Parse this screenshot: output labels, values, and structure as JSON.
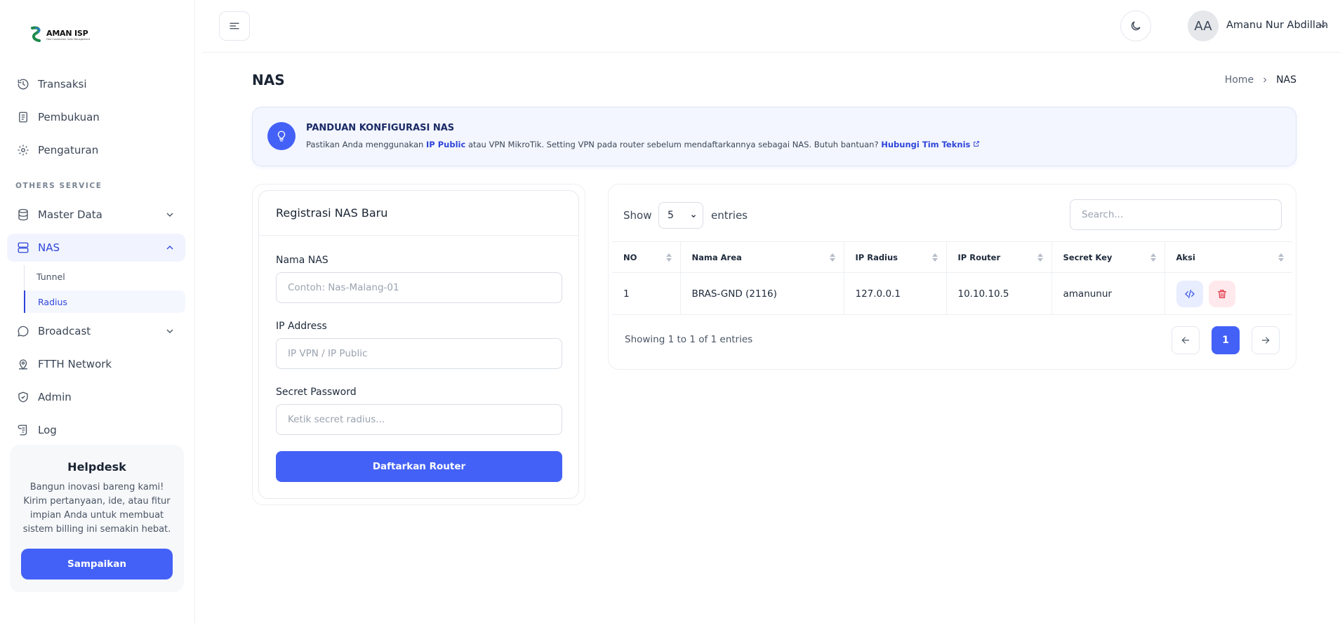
{
  "brand": {
    "name": "AMAN ISP",
    "tagline": "Fast Connection, Safe Management"
  },
  "sidebar": {
    "items_top": [
      {
        "label": "Transaksi",
        "icon": "history-icon"
      },
      {
        "label": "Pembukuan",
        "icon": "ledger-icon"
      },
      {
        "label": "Pengaturan",
        "icon": "gear-icon"
      }
    ],
    "section_label": "OTHERS SERVICE",
    "master_data": "Master Data",
    "nas": "NAS",
    "nas_sub": [
      "Tunnel",
      "Radius"
    ],
    "broadcast": "Broadcast",
    "ftth": "FTTH Network",
    "admin": "Admin",
    "log": "Log"
  },
  "helpdesk": {
    "title": "Helpdesk",
    "text": "Bangun inovasi bareng kami! Kirim pertanyaan, ide, atau fitur impian Anda untuk membuat sistem billing ini semakin hebat.",
    "button": "Sampaikan"
  },
  "header": {
    "avatar_initials": "AA",
    "user_name": "Amanu Nur Abdillah"
  },
  "page": {
    "title": "NAS",
    "breadcrumb_home": "Home",
    "breadcrumb_current": "NAS"
  },
  "alert": {
    "title": "PANDUAN KONFIGURASI NAS",
    "text_1": "Pastikan Anda menggunakan",
    "highlight": "IP Public",
    "text_2": "atau VPN MikroTik. Setting VPN pada router sebelum mendaftarkannya sebagai NAS. Butuh bantuan?",
    "link": "Hubungi Tim Teknis"
  },
  "form": {
    "title": "Registrasi NAS Baru",
    "name_label": "Nama NAS",
    "name_placeholder": "Contoh: Nas-Malang-01",
    "ip_label": "IP Address",
    "ip_placeholder": "IP VPN / IP Public",
    "secret_label": "Secret Password",
    "secret_placeholder": "Ketik secret radius...",
    "submit": "Daftarkan Router"
  },
  "table": {
    "show_label": "Show",
    "entries_value": "5",
    "entries_label": "entries",
    "search_placeholder": "Search...",
    "columns": [
      "NO",
      "Nama Area",
      "IP Radius",
      "IP Router",
      "Secret Key",
      "Aksi"
    ],
    "rows": [
      {
        "no": "1",
        "area": "BRAS-GND (2116)",
        "ip_radius": "127.0.0.1",
        "ip_router": "10.10.10.5",
        "secret": "amanunur"
      }
    ],
    "showing": "Showing 1 to 1 of 1 entries",
    "current_page": "1"
  }
}
